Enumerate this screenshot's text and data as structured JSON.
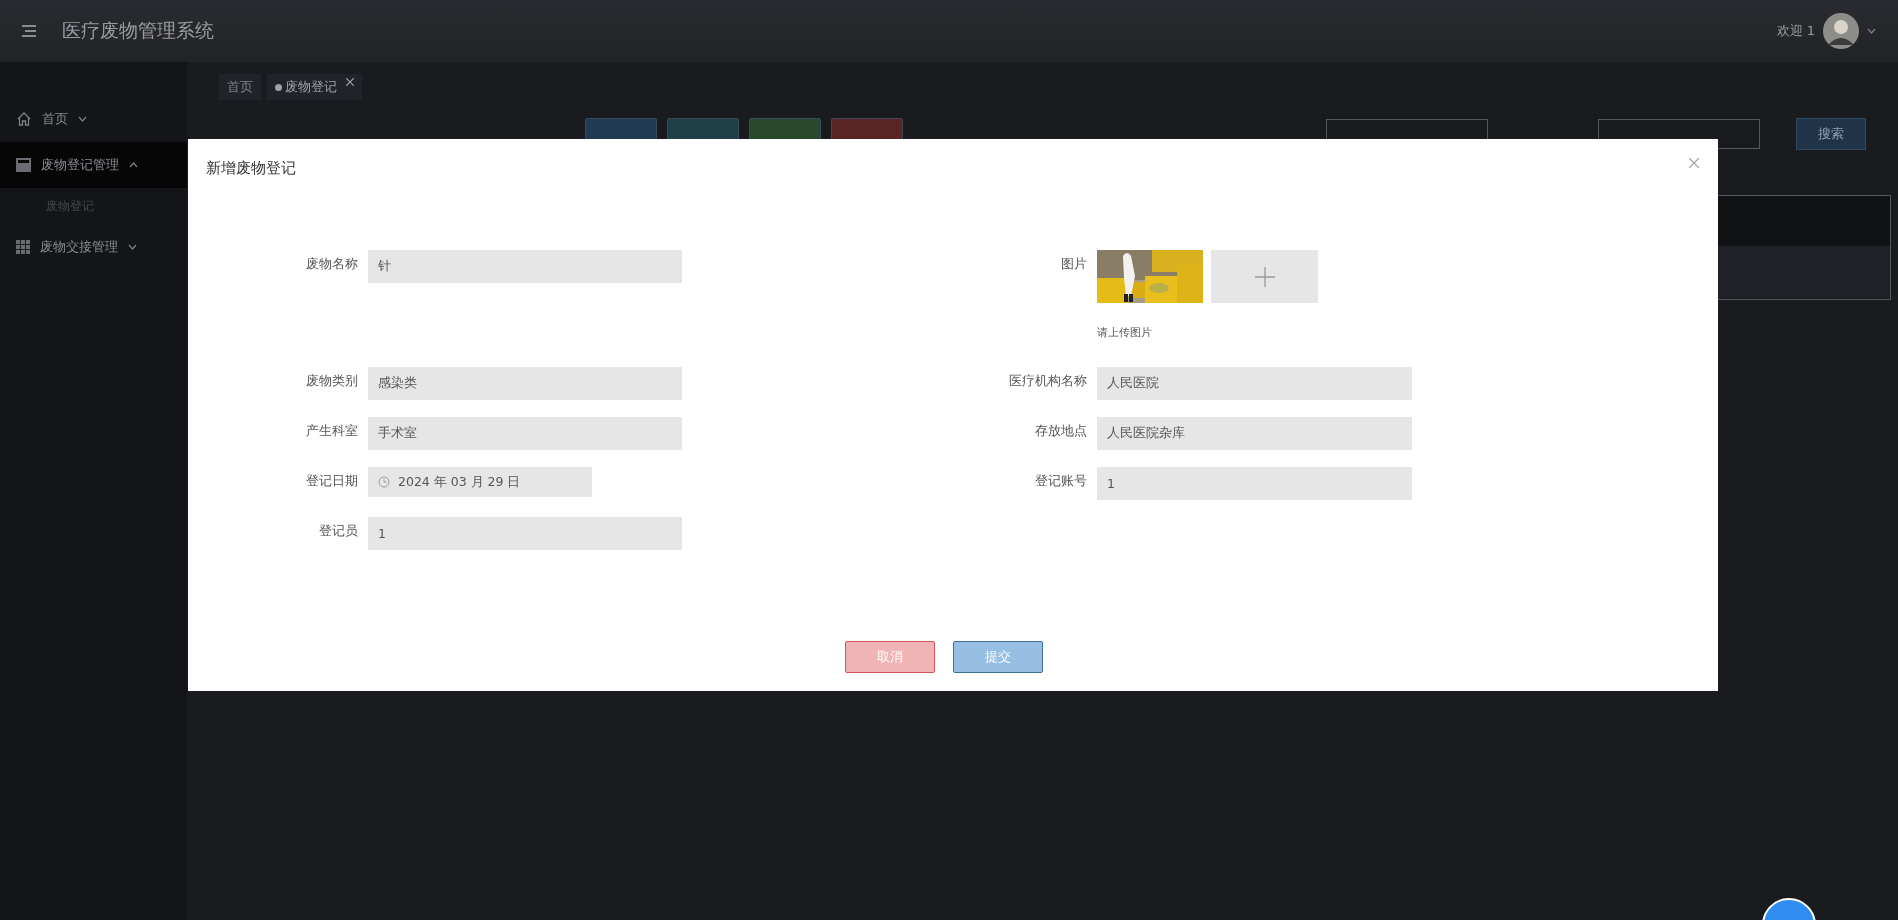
{
  "header": {
    "title": "医疗废物管理系统",
    "welcome": "欢迎 1"
  },
  "sidebar": {
    "items": [
      {
        "kind": "home",
        "label": "首页",
        "expanded": false,
        "selected": false
      },
      {
        "kind": "store",
        "label": "废物登记管理",
        "expanded": true,
        "selected": true,
        "children": [
          {
            "label": "废物登记"
          }
        ]
      },
      {
        "kind": "grid",
        "label": "废物交接管理",
        "expanded": false,
        "selected": false
      }
    ]
  },
  "tabs": [
    {
      "label": "首页",
      "selected": false,
      "closable": false
    },
    {
      "label": "废物登记",
      "selected": true,
      "closable": true
    }
  ],
  "toolbar": {
    "buttons": [
      {
        "color": "#1f3a52"
      },
      {
        "color": "#1f4049"
      },
      {
        "color": "#27482a"
      },
      {
        "color": "#5a2424"
      }
    ],
    "search_button": "搜索"
  },
  "dialog": {
    "title": "新增废物登记",
    "rows": [
      {
        "left": {
          "kind": "text",
          "label": "废物名称",
          "value": "针"
        },
        "right": {
          "kind": "upload",
          "label": "图片",
          "hint": "请上传图片"
        }
      },
      {
        "left": {
          "kind": "text",
          "label": "废物类别",
          "value": "感染类"
        },
        "right": {
          "kind": "text",
          "label": "医疗机构名称",
          "value": "人民医院"
        }
      },
      {
        "left": {
          "kind": "text",
          "label": "产生科室",
          "value": "手术室"
        },
        "right": {
          "kind": "text",
          "label": "存放地点",
          "value": "人民医院杂库"
        }
      },
      {
        "left": {
          "kind": "date",
          "label": "登记日期",
          "value": "2024 年 03 月 29 日"
        },
        "right": {
          "kind": "text",
          "label": "登记账号",
          "value": "1"
        }
      },
      {
        "left": {
          "kind": "text",
          "label": "登记员",
          "value": "1"
        }
      }
    ],
    "buttons": [
      {
        "kind": "cancel",
        "label": "取消"
      },
      {
        "kind": "submit",
        "label": "提交"
      }
    ]
  }
}
